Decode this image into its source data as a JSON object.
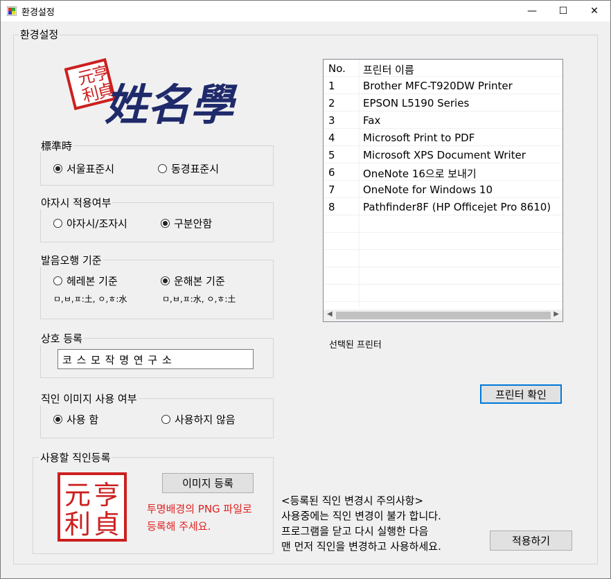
{
  "window": {
    "title": "환경설정",
    "controls": {
      "minimize": "—",
      "maximize": "☐",
      "close": "✕"
    }
  },
  "main_group": {
    "legend": "환경설정"
  },
  "logo": {
    "seal_text": "元亨利貞",
    "name_text": "姓名學"
  },
  "standard_time": {
    "legend": "標準時",
    "options": [
      {
        "label": "서울표준시",
        "checked": true
      },
      {
        "label": "동경표준시",
        "checked": false
      }
    ]
  },
  "night_hour": {
    "legend": "야자시 적용여부",
    "options": [
      {
        "label": "야자시/조자시",
        "checked": false
      },
      {
        "label": "구분안함",
        "checked": true
      }
    ]
  },
  "pronunciation": {
    "legend": "발음오행 기준",
    "options": [
      {
        "label": "헤레본 기준",
        "note": "ㅁ,ㅂ,ㅍ:土, ㅇ,ㅎ:水",
        "checked": false
      },
      {
        "label": "운해본 기준",
        "note": "ㅁ,ㅂ,ㅍ:水, ㅇ,ㅎ:土",
        "checked": true
      }
    ]
  },
  "business_name": {
    "legend": "상호 등록",
    "value": "코 스 모 작 명 연 구 소"
  },
  "seal_usage": {
    "legend": "직인 이미지 사용 여부",
    "options": [
      {
        "label": "사용 함",
        "checked": true
      },
      {
        "label": "사용하지 않음",
        "checked": false
      }
    ]
  },
  "seal_register": {
    "legend": "사용할 직인등록",
    "image_text": "元亨利貞",
    "button": "이미지 등록",
    "hint_line1": "투명배경의 PNG 파일로",
    "hint_line2": "등록해 주세요."
  },
  "printers": {
    "headers": [
      "No.",
      "프린터 이름"
    ],
    "rows": [
      [
        "1",
        "Brother MFC-T920DW Printer"
      ],
      [
        "2",
        "EPSON L5190 Series"
      ],
      [
        "3",
        "Fax"
      ],
      [
        "4",
        "Microsoft Print to PDF"
      ],
      [
        "5",
        "Microsoft XPS Document Writer"
      ],
      [
        "6",
        "OneNote 16으로 보내기"
      ],
      [
        "7",
        "OneNote for Windows 10"
      ],
      [
        "8",
        "Pathfinder8F (HP Officejet Pro 8610)"
      ]
    ],
    "selected_label": "선택된 프린터",
    "check_button": "프린터 확인"
  },
  "notice": {
    "line1": "<등록된 직인 변경시 주의사항>",
    "line2": "사용중에는 직인 변경이 불가 합니다.",
    "line3": "프로그램을 닫고 다시 실행한 다음",
    "line4": "맨 먼저 직인을 변경하고 사용하세요."
  },
  "apply_button": "적용하기",
  "colors": {
    "seal_red": "#cc1f1f",
    "logo_navy": "#1f2a6b",
    "hint_red": "#e02020",
    "focus_blue": "#0078d7"
  }
}
